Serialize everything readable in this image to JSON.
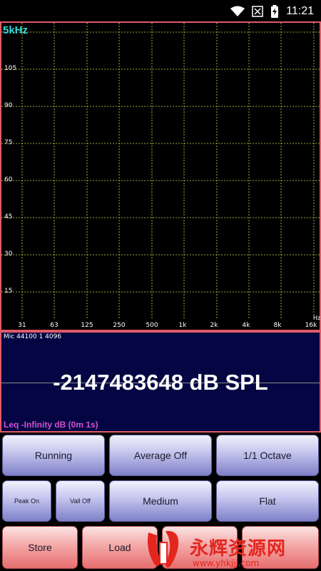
{
  "status_bar": {
    "time": "11:21"
  },
  "spectrum": {
    "freq_label": "5kHz",
    "y_ticks": [
      "105",
      "90",
      "75",
      "60",
      "45",
      "30",
      "15"
    ],
    "x_ticks": [
      "31",
      "63",
      "125",
      "250",
      "500",
      "1k",
      "2k",
      "4k",
      "8k",
      "16k"
    ],
    "x_unit": "Hz"
  },
  "meter": {
    "mic_info": "Mic 44100 1 4096",
    "spl": "-2147483648 dB SPL",
    "leq": "Leq -Infinity dB (0m 1s)"
  },
  "buttons": {
    "running": "Running",
    "average": "Average Off",
    "octave": "1/1 Octave",
    "peak": "Peak On",
    "vall": "Vall Off",
    "speed": "Medium",
    "weighting": "Flat",
    "store": "Store",
    "load": "Load"
  },
  "watermark": {
    "cn": "永辉资源网",
    "url": "www.yhkjjj.com"
  },
  "colors": {
    "panel_border": "#e05a67",
    "meter_bg": "#030642",
    "freq_label": "#36d8d8",
    "leq_text": "#d24fd2",
    "grid": "#d8d84a"
  }
}
